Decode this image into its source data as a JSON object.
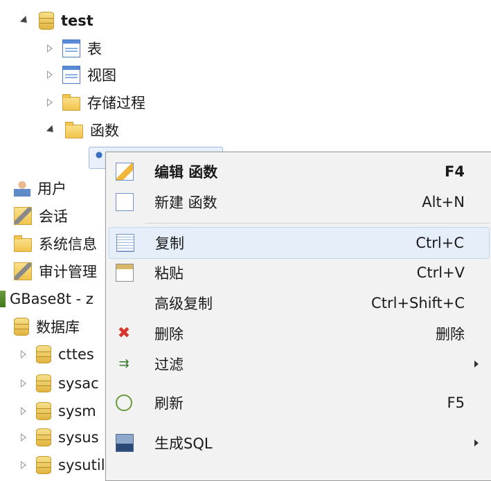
{
  "tree": {
    "root": "test",
    "items": [
      {
        "label": "表"
      },
      {
        "label": "视图"
      },
      {
        "label": "存储过程"
      },
      {
        "label": "函数"
      }
    ],
    "user": "用户",
    "session": "会话",
    "sysinfo": "系统信息",
    "audit": "审计管理",
    "server": "GBase8t - z",
    "databases": "数据库",
    "dbs": [
      "cttes",
      "sysac",
      "sysm",
      "sysus",
      "sysutils"
    ]
  },
  "menu": {
    "edit": {
      "label": "编辑 函数",
      "key": "F4"
    },
    "new": {
      "label": "新建 函数",
      "key": "Alt+N"
    },
    "copy": {
      "label": "复制",
      "key": "Ctrl+C"
    },
    "paste": {
      "label": "粘贴",
      "key": "Ctrl+V"
    },
    "advcopy": {
      "label": "高级复制",
      "key": "Ctrl+Shift+C"
    },
    "delete": {
      "label": "删除",
      "key": "删除"
    },
    "filter": {
      "label": "过滤"
    },
    "refresh": {
      "label": "刷新",
      "key": "F5"
    },
    "gensql": {
      "label": "生成SQL"
    }
  }
}
